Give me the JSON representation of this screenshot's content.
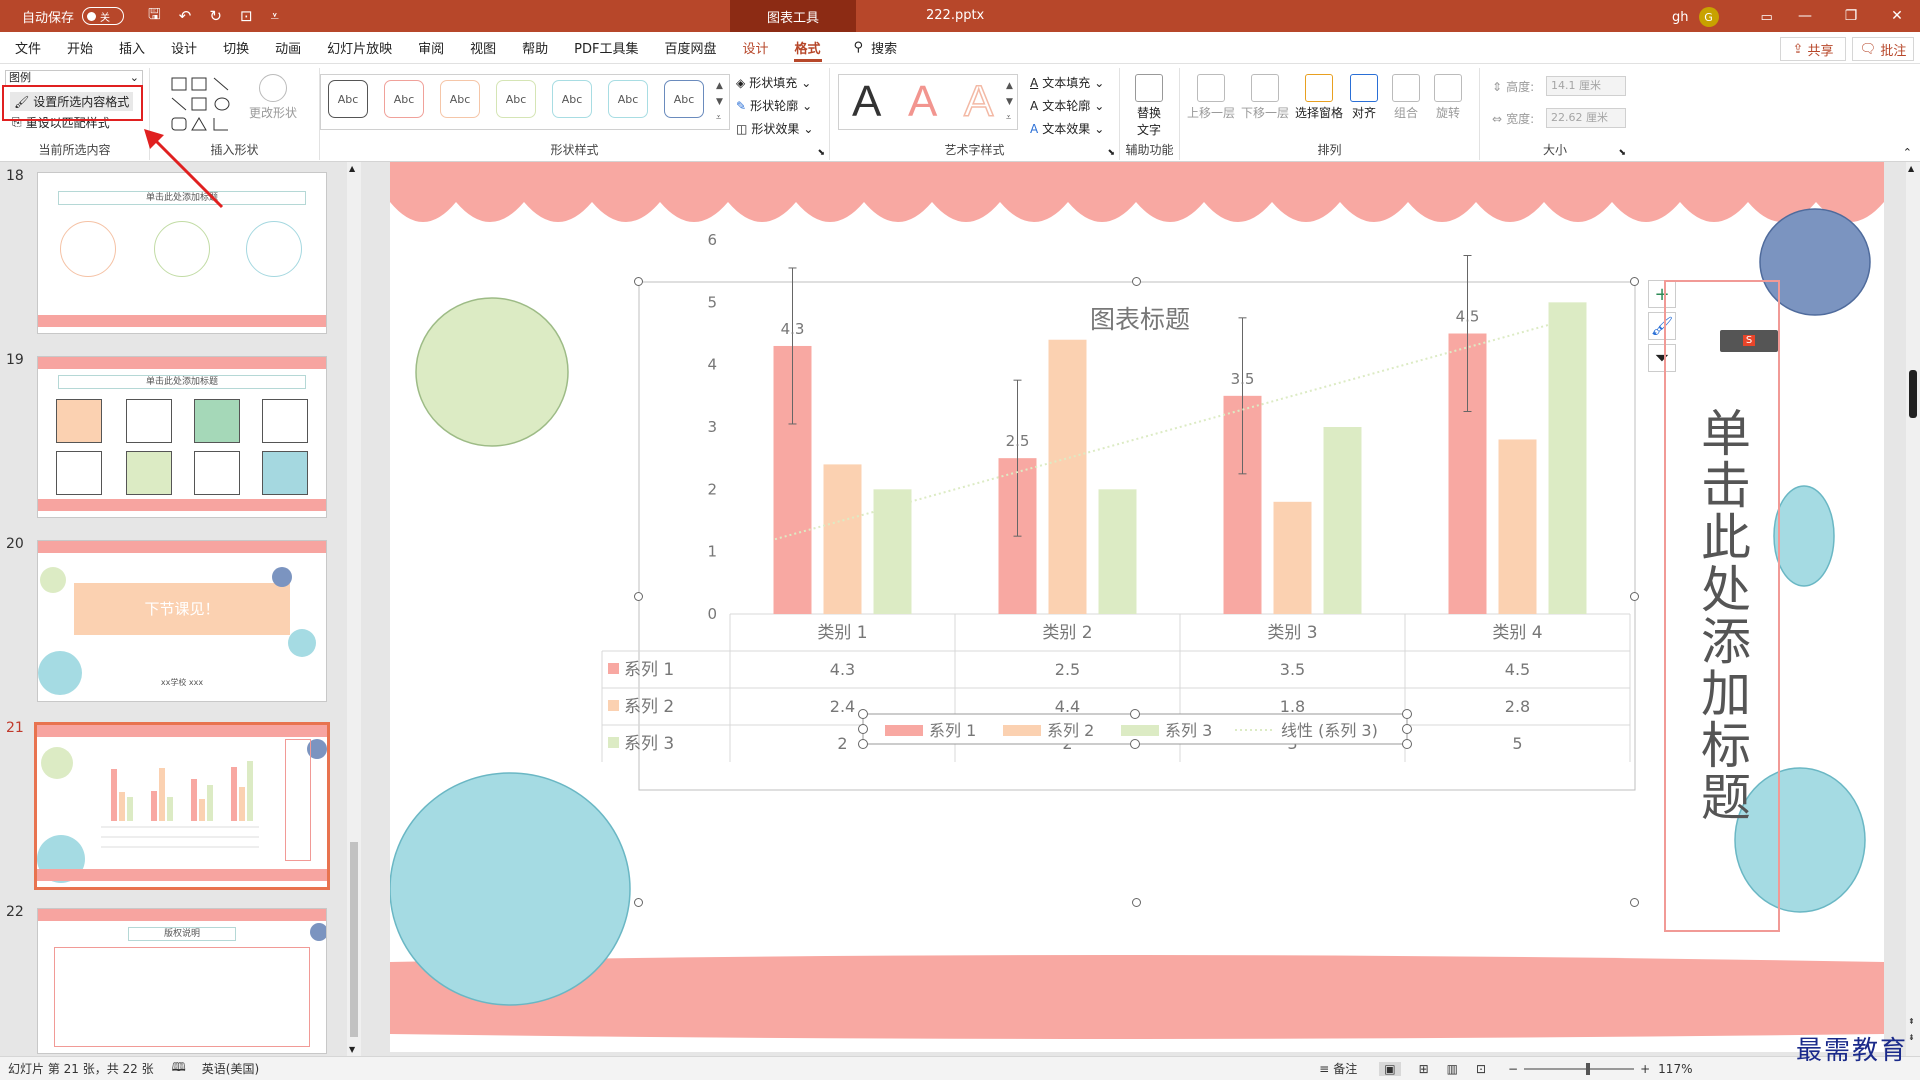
{
  "titlebar": {
    "autosave_label": "自动保存",
    "autosave_state": "关",
    "context_tab": "图表工具",
    "filename": "222.pptx",
    "user": "gh",
    "avatar_letter": "G"
  },
  "menu": {
    "tabs": [
      "文件",
      "开始",
      "插入",
      "设计",
      "切换",
      "动画",
      "幻灯片放映",
      "审阅",
      "视图",
      "帮助",
      "PDF工具集",
      "百度网盘",
      "设计",
      "格式"
    ],
    "search": "搜索",
    "share": "共享",
    "comment": "批注"
  },
  "ribbon": {
    "selection_value": "图例",
    "format_selection": "设置所选内容格式",
    "reset_style": "重设以匹配样式",
    "group_current": "当前所选内容",
    "change_shape": "更改形状",
    "group_insert_shape": "插入形状",
    "shape_style_sample": "Abc",
    "shape_fill": "形状填充",
    "shape_outline": "形状轮廓",
    "shape_effect": "形状效果",
    "group_shape_styles": "形状样式",
    "wordart_letter": "A",
    "text_fill": "文本填充",
    "text_outline": "文本轮廓",
    "text_effect": "文本效果",
    "group_wordart": "艺术字样式",
    "alt_text_line1": "替换",
    "alt_text_line2": "文字",
    "group_accessibility": "辅助功能",
    "bring_forward": "上移一层",
    "send_backward": "下移一层",
    "selection_pane": "选择窗格",
    "align": "对齐",
    "group_btn": "组合",
    "rotate": "旋转",
    "group_arrange": "排列",
    "height_label": "高度:",
    "height_value": "14.1 厘米",
    "width_label": "宽度:",
    "width_value": "22.62 厘米",
    "group_size": "大小"
  },
  "slides": {
    "numbers": [
      "18",
      "19",
      "20",
      "21",
      "22"
    ],
    "s18_title": "单击此处添加标题",
    "s19_title": "单击此处添加标题",
    "s20_text": "下节课见！",
    "s20_sub": "xx学校 xxx",
    "s22_title": "版权说明"
  },
  "slide": {
    "vertical_title": "单击此处添加标题"
  },
  "chart_data": {
    "type": "bar",
    "title": "图表标题",
    "categories": [
      "类别 1",
      "类别 2",
      "类别 3",
      "类别 4"
    ],
    "ylim": [
      0,
      6
    ],
    "yticks": [
      "0",
      "1",
      "2",
      "3",
      "4",
      "5",
      "6"
    ],
    "series": [
      {
        "name": "系列 1",
        "values": [
          4.3,
          2.5,
          3.5,
          4.5
        ],
        "color": "#f8a8a2"
      },
      {
        "name": "系列 2",
        "values": [
          2.4,
          4.4,
          1.8,
          2.8
        ],
        "color": "#fbd1b1"
      },
      {
        "name": "系列 3",
        "values": [
          2,
          2,
          3,
          5
        ],
        "color": "#dcebc4"
      }
    ],
    "data_labels_series1": [
      "4.3",
      "2.5",
      "3.5",
      "4.5"
    ],
    "trendline": "线性 (系列 3)",
    "table_rows": [
      {
        "name": "系列 1",
        "values": [
          "4.3",
          "2.5",
          "3.5",
          "4.5"
        ]
      },
      {
        "name": "系列 2",
        "values": [
          "2.4",
          "4.4",
          "1.8",
          "2.8"
        ]
      },
      {
        "name": "系列 3",
        "values": [
          "2",
          "2",
          "3",
          "5"
        ]
      }
    ],
    "legend_position": "bottom",
    "grid": false
  },
  "status": {
    "slide_info": "幻灯片 第 21 张，共 22 张",
    "language": "英语(美国)",
    "notes": "备注",
    "zoom": "117%"
  },
  "watermark": "最需教育"
}
